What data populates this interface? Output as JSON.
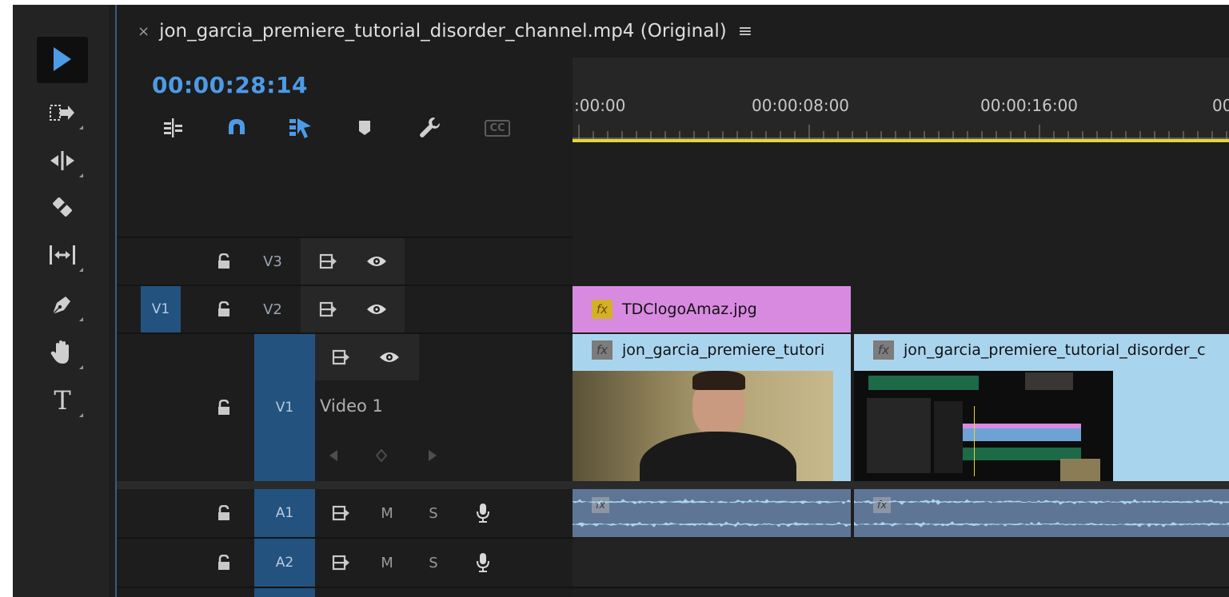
{
  "tools": [
    {
      "name": "selection-tool"
    },
    {
      "name": "track-select-forward-tool"
    },
    {
      "name": "ripple-edit-tool"
    },
    {
      "name": "razor-tool"
    },
    {
      "name": "slip-tool"
    },
    {
      "name": "pen-tool"
    },
    {
      "name": "hand-tool"
    },
    {
      "name": "type-tool",
      "glyph": "T"
    }
  ],
  "sequence": {
    "close_glyph": "×",
    "title": "jon_garcia_premiere_tutorial_disorder_channel.mp4 (Original)",
    "menu_glyph": "≡",
    "timecode": "00:00:28:14",
    "cc_label": "CC"
  },
  "tracks": {
    "v3": {
      "name": "V3"
    },
    "v2": {
      "name": "V2",
      "source": "V1"
    },
    "v1": {
      "name": "V1",
      "label": "Video 1"
    },
    "a1": {
      "name": "A1",
      "mute": "M",
      "solo": "S"
    },
    "a2": {
      "name": "A2",
      "mute": "M",
      "solo": "S"
    }
  },
  "ruler": {
    "labels": [
      ":00:00",
      "00:00:08:00",
      "00:00:16:00",
      "00"
    ]
  },
  "clips": {
    "v2_clip": {
      "fx": "fx",
      "name": "TDClogoAmaz.jpg",
      "color": "#d88ae0"
    },
    "v1_clip1": {
      "fx": "fx",
      "name": "jon_garcia_premiere_tutori",
      "color": "#a9d4ee"
    },
    "v1_clip2": {
      "fx": "fx",
      "name": "jon_garcia_premiere_tutorial_disorder_c",
      "color": "#a9d4ee"
    },
    "a1_clip1": {
      "fx": "fx",
      "color": "#5f7596"
    },
    "a1_clip2": {
      "fx": "fx",
      "color": "#5f7596"
    }
  },
  "colors": {
    "accent": "#4d9be6",
    "track_target": "#23527f",
    "work_area": "#e6d538"
  }
}
